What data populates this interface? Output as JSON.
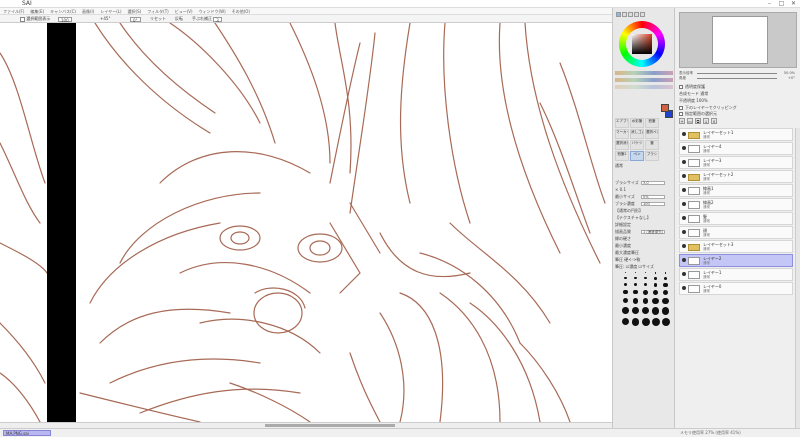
{
  "window": {
    "title": "SAI"
  },
  "menu": [
    "ファイル(F)",
    "編集(E)",
    "キャンバス(C)",
    "画像(I)",
    "レイヤー(L)",
    "選択(S)",
    "フィルタ(T)",
    "ビュー(V)",
    "ウィンドウ(W)",
    "その他(O)"
  ],
  "toolbar": {
    "stabilizer_label": "選択範囲表示",
    "zoom_value": "100",
    "rotate_label": "+45°",
    "rotate_value": "0°",
    "reset_label": "リセット",
    "flip_label": "反転",
    "stab_label": "手ぶれ補正",
    "stab_value": "3"
  },
  "color": {
    "fg": "#d06040",
    "bg": "#2040d0"
  },
  "tools": [
    [
      "エアブラシ",
      "水彩筆",
      "鉛筆"
    ],
    [
      "マーカー",
      "消しゴム",
      "選択ペン"
    ],
    [
      "選択消し",
      "バケツ",
      "筆"
    ],
    [
      "鉛筆2",
      "ペン",
      "ブラシ"
    ]
  ],
  "tool_props": {
    "mode_label": "通常",
    "size_label": "ブラシサイズ",
    "size_value": "× 0.1",
    "size_num": "3.0",
    "min_size_label": "最小サイズ",
    "min_size_value": "0%",
    "density_label": "ブラシ濃度",
    "density_value": "100",
    "shape_label": "【通常の円形】",
    "texture_label": "【テクスチャなし】",
    "detail_label": "詳細設定",
    "quality_label": "描画品質",
    "quality_value": "1 (速度優先)",
    "edge_label": "縁の硬さ",
    "min_density_label": "最小濃度",
    "pressure_label": "最大濃度筆圧",
    "pressure_hard_label": "筆圧 硬<->軟",
    "pressure_check": "筆圧: ☑濃度 ☑サイズ"
  },
  "size_grid": [
    "0.7",
    "0.8",
    "1",
    "1.5",
    "2",
    "2.3",
    "2.6",
    "3",
    "3.5",
    "4",
    "5",
    "6",
    "7",
    "8",
    "9",
    "10",
    "12",
    "14",
    "16",
    "20",
    "25",
    "30",
    "35",
    "40",
    "50",
    "60",
    "70",
    "80",
    "100",
    "120",
    "160",
    "200",
    "250",
    "300",
    "350"
  ],
  "navigator": {
    "zoom_label": "表示倍率",
    "zoom_value": "50.0%",
    "angle_label": "角度",
    "angle_value": "+0°"
  },
  "layer_panel": {
    "protect_opacity": "透明度保護",
    "mode_label": "合成モード",
    "mode_value": "通常",
    "opacity_label": "不透明度",
    "opacity_value": "100%",
    "clip_label": "下のレイヤーでクリッピング",
    "select_source_label": "指定範囲の選択元"
  },
  "layers": [
    {
      "name": "レイヤーセット1",
      "mode": "通常",
      "type": "folder",
      "selected": false
    },
    {
      "name": "レイヤー4",
      "mode": "通常",
      "type": "layer",
      "selected": false
    },
    {
      "name": "レイヤー3",
      "mode": "通常",
      "type": "layer",
      "selected": false
    },
    {
      "name": "レイヤーセット2",
      "mode": "通常",
      "type": "folder",
      "selected": false
    },
    {
      "name": "線画1",
      "mode": "通常",
      "type": "layer",
      "selected": false
    },
    {
      "name": "線画2",
      "mode": "通常",
      "type": "layer",
      "selected": false
    },
    {
      "name": "髪",
      "mode": "通常",
      "type": "layer",
      "selected": false
    },
    {
      "name": "顔",
      "mode": "通常",
      "type": "layer",
      "selected": false
    },
    {
      "name": "レイヤーセット3",
      "mode": "通常",
      "type": "folder",
      "selected": false
    },
    {
      "name": "レイヤー2",
      "mode": "通常",
      "type": "layer",
      "selected": true
    },
    {
      "name": "レイヤー1",
      "mode": "通常",
      "type": "layer",
      "selected": false
    },
    {
      "name": "レイヤー0",
      "mode": "通常",
      "type": "layer",
      "selected": false
    }
  ],
  "status": {
    "document_tab": "MA.PNG.sai",
    "memory": "メモリ使用率 27% (使用率 41%)",
    "drive": "ドライブ空き容量 51%"
  },
  "colors": {
    "lineart": "#a86a56",
    "selection": "#c4c6f6"
  }
}
